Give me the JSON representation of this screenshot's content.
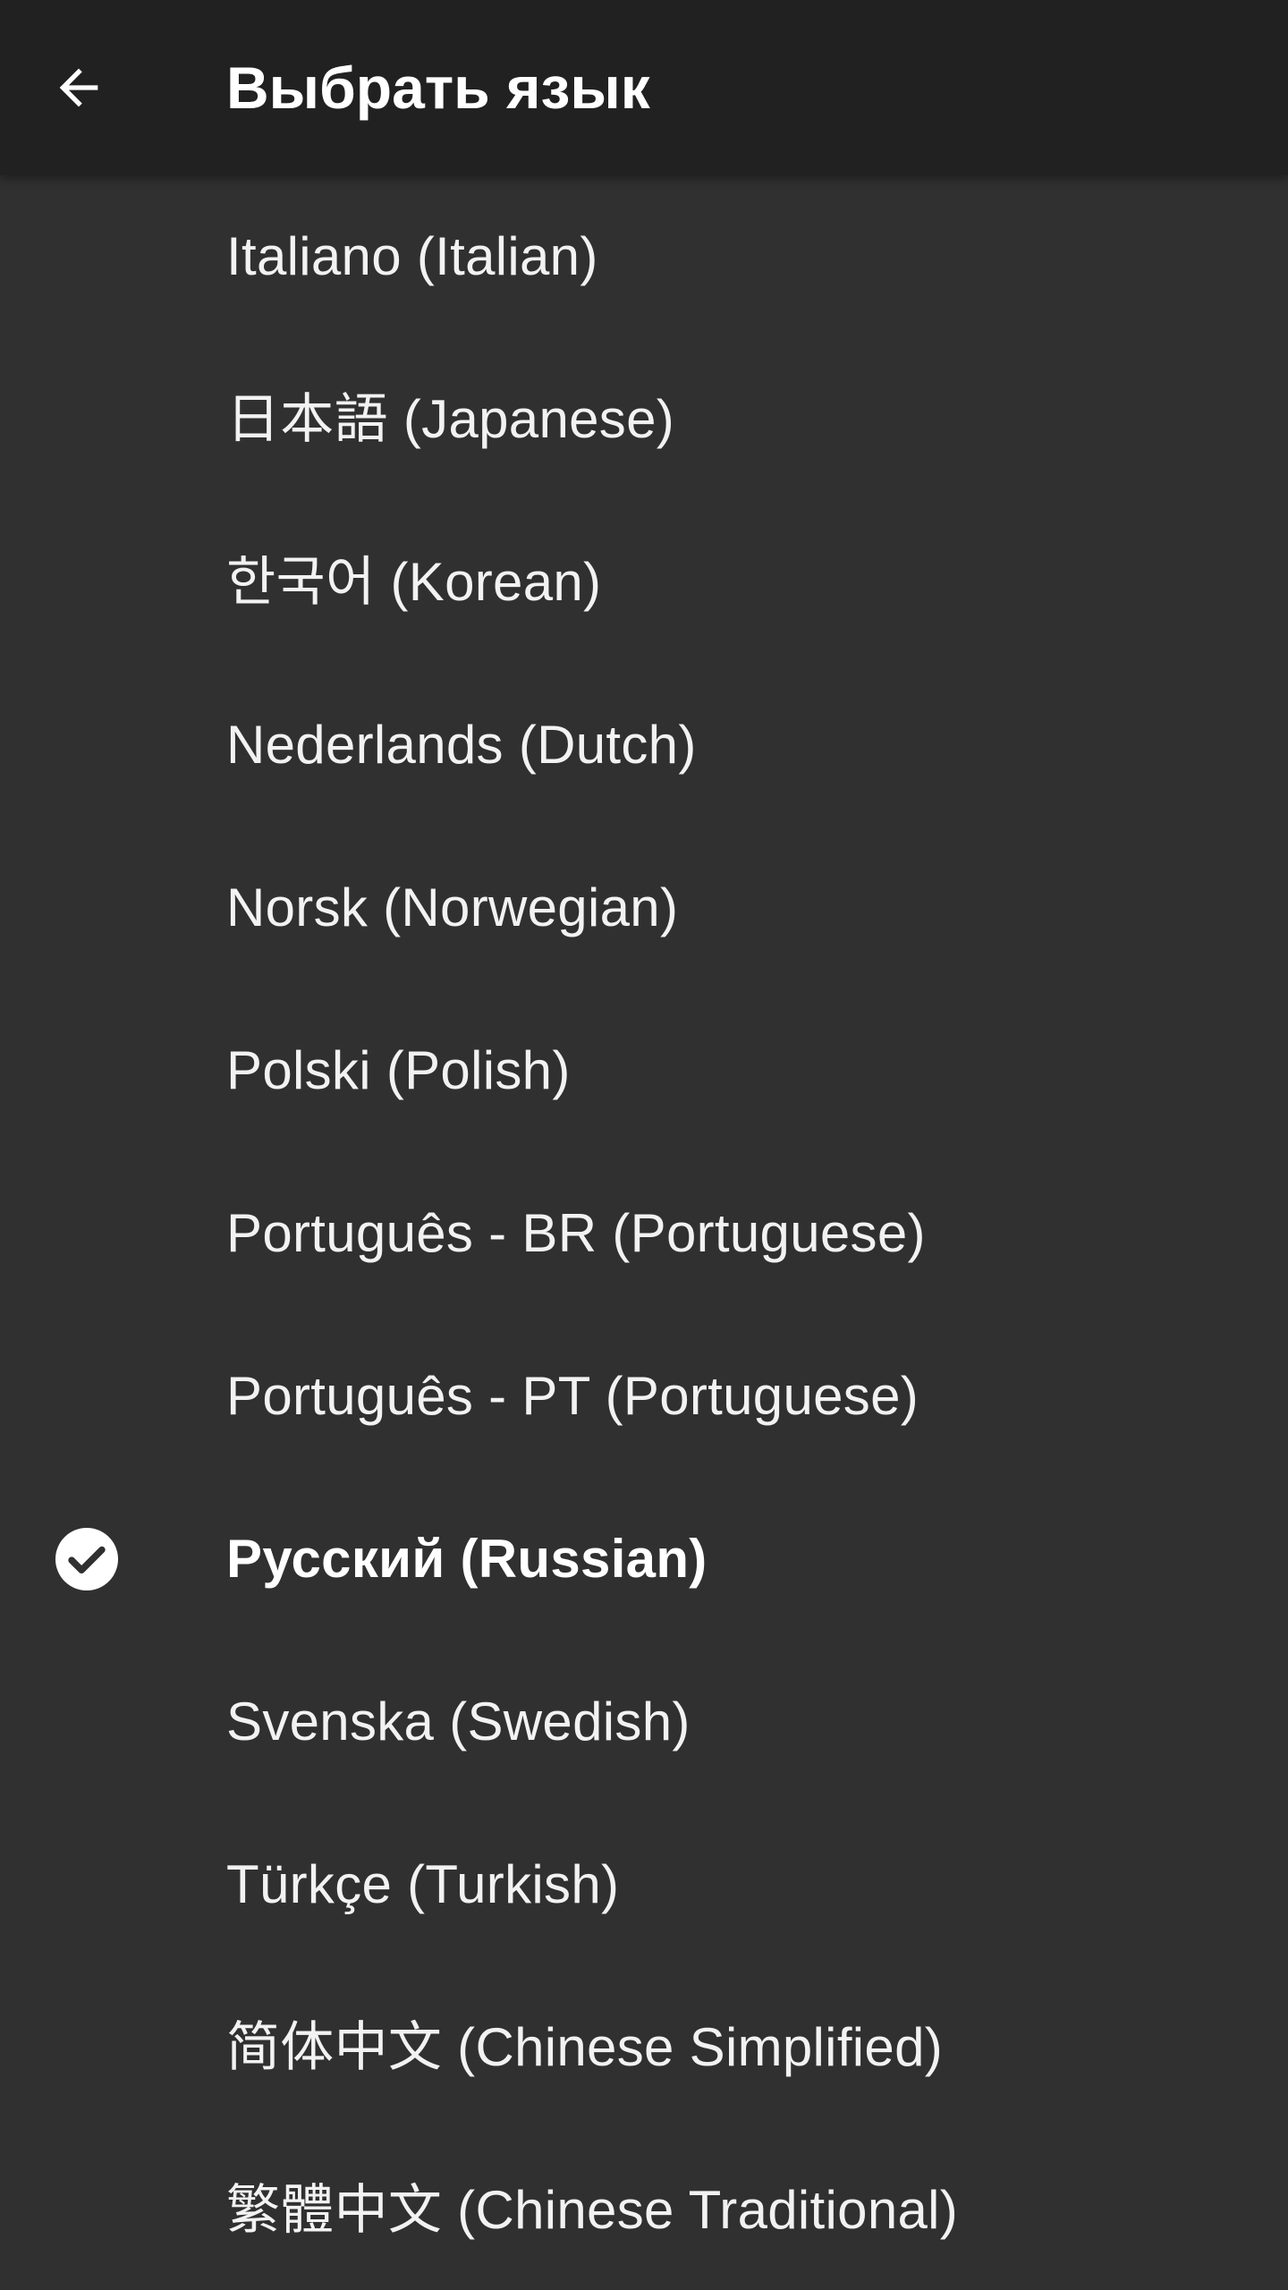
{
  "header": {
    "title": "Выбрать язык",
    "back_icon": "arrow-back-icon"
  },
  "languages": [
    {
      "label": "Italiano (Italian)",
      "selected": false
    },
    {
      "label": "日本語 (Japanese)",
      "selected": false
    },
    {
      "label": "한국어 (Korean)",
      "selected": false
    },
    {
      "label": "Nederlands (Dutch)",
      "selected": false
    },
    {
      "label": "Norsk (Norwegian)",
      "selected": false
    },
    {
      "label": "Polski (Polish)",
      "selected": false
    },
    {
      "label": "Português - BR (Portuguese)",
      "selected": false
    },
    {
      "label": "Português - PT (Portuguese)",
      "selected": false
    },
    {
      "label": "Русский (Russian)",
      "selected": true
    },
    {
      "label": "Svenska (Swedish)",
      "selected": false
    },
    {
      "label": "Türkçe (Turkish)",
      "selected": false
    },
    {
      "label": "简体中文 (Chinese Simplified)",
      "selected": false
    },
    {
      "label": "繁體中文 (Chinese Traditional)",
      "selected": false
    }
  ],
  "selected_icon": "check-circle-icon",
  "colors": {
    "app_bar": "#212121",
    "background": "#303030",
    "text": "#ffffff"
  }
}
